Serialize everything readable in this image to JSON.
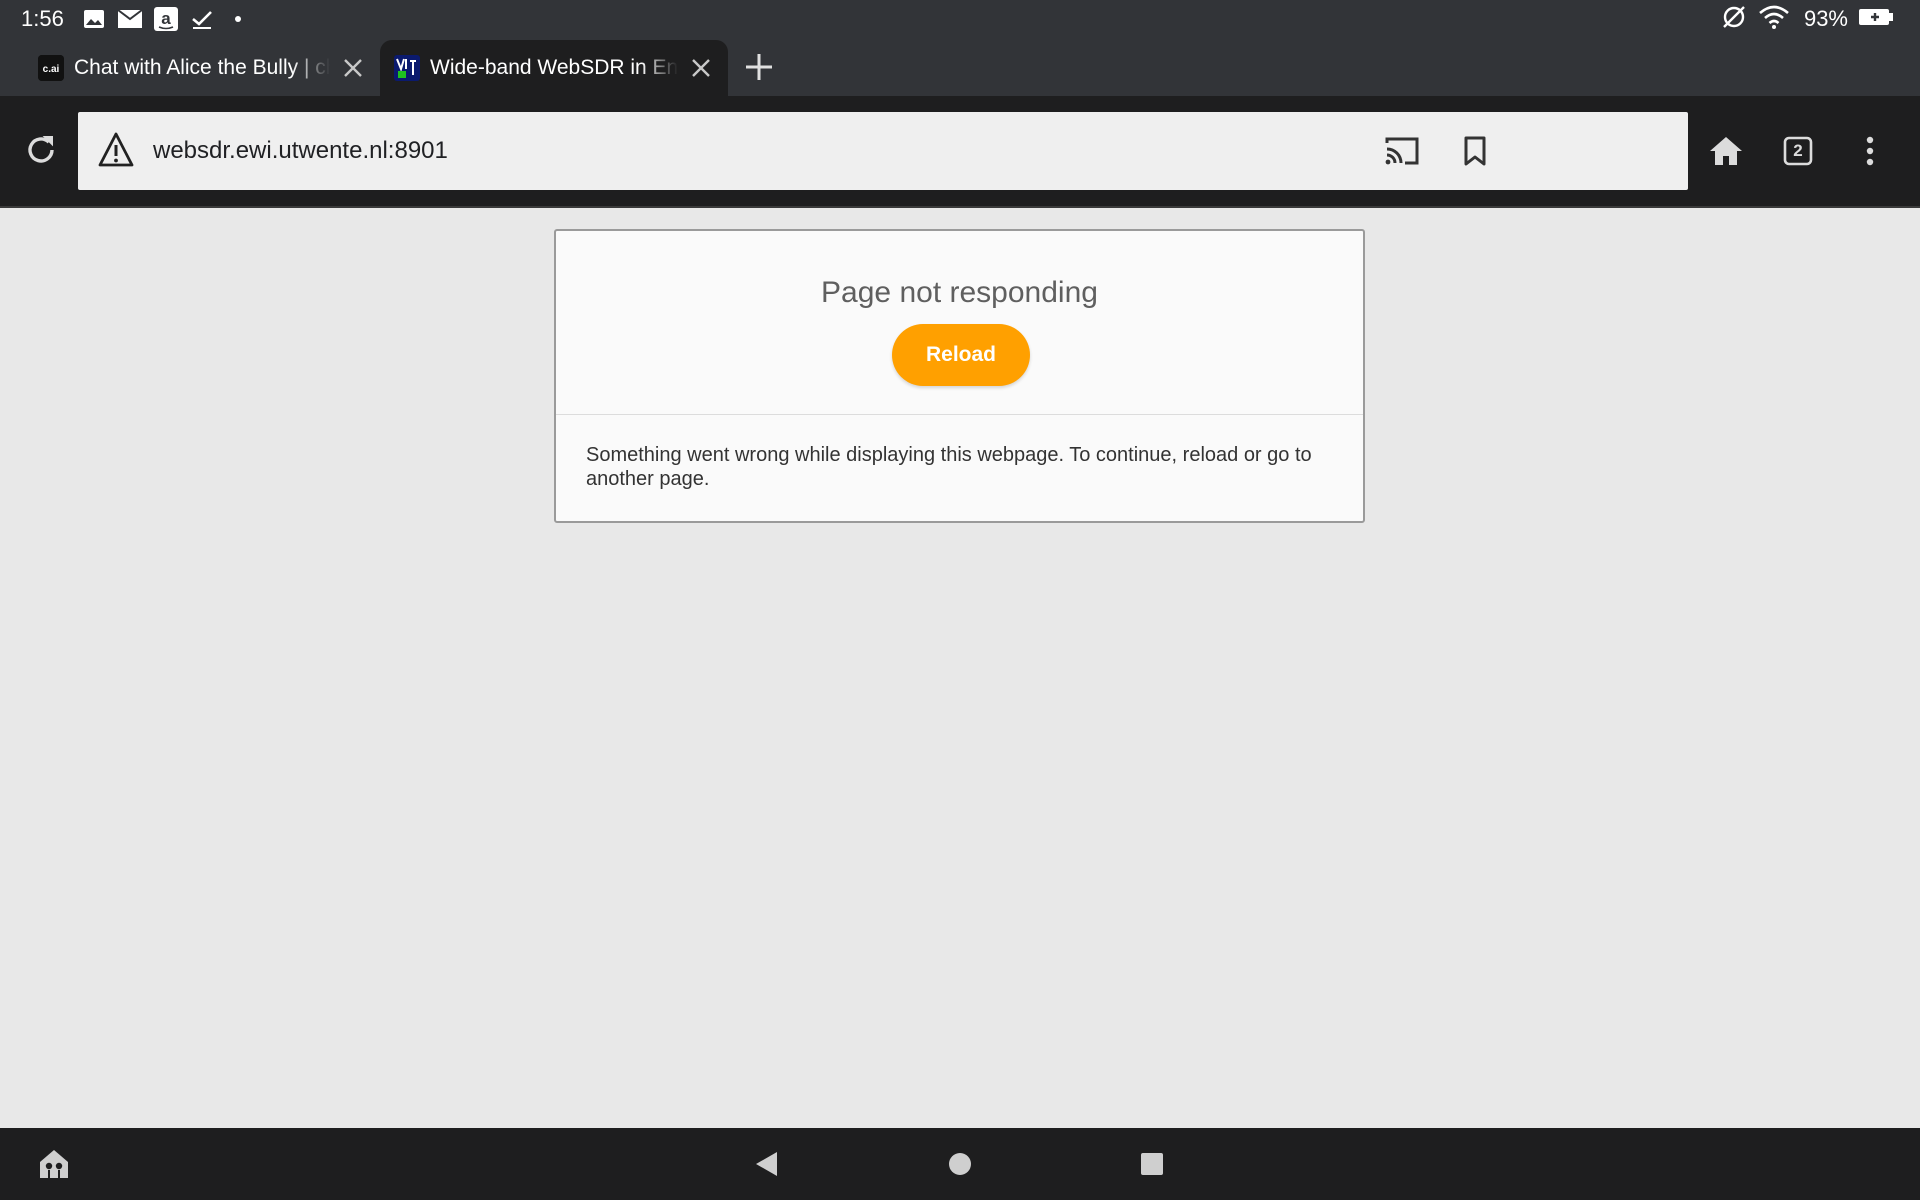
{
  "status_bar": {
    "time": "1:56",
    "battery_percent": "93%",
    "icons": [
      "image-icon",
      "mail-icon",
      "amazon-icon",
      "checkmark-icon",
      "dot-icon"
    ],
    "right_icons": [
      "no-sync-icon",
      "wifi-icon",
      "battery-charging-icon"
    ]
  },
  "tabs": [
    {
      "title": "Chat with Alice the Bully | character.ai",
      "favicon": "c.ai",
      "active": false
    },
    {
      "title": "Wide-band WebSDR in Enschede",
      "favicon": "websdr",
      "active": true
    }
  ],
  "toolbar": {
    "url": "websdr.ewi.utwente.nl:8901",
    "tab_count": "2"
  },
  "dialog": {
    "title": "Page not responding",
    "reload_label": "Reload",
    "message": "Something went wrong while displaying this webpage. To continue, reload or go to another page."
  },
  "colors": {
    "accent": "#ffa000",
    "chrome_dark": "#1e1e1f",
    "status_bar": "#323438",
    "content_bg": "#e8e8e8"
  }
}
